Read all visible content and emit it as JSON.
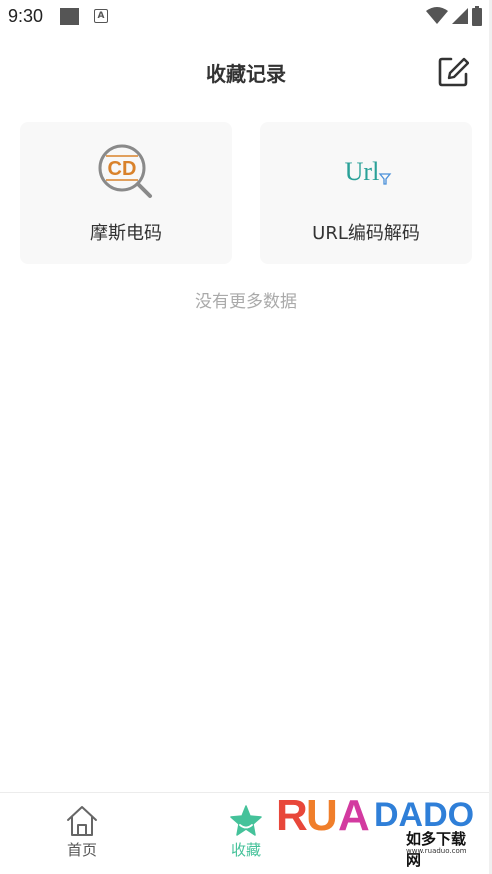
{
  "status_bar": {
    "time": "9:30",
    "icons": [
      "notification-square-icon",
      "a-badge-icon",
      "wifi-icon",
      "signal-icon",
      "battery-icon"
    ]
  },
  "header": {
    "title": "收藏记录",
    "edit_icon": "edit-square-icon"
  },
  "favorites": [
    {
      "label": "摩斯电码",
      "icon": "cd-magnifier-icon",
      "icon_text": "CD"
    },
    {
      "label": "URL编码解码",
      "icon": "url-filter-icon",
      "icon_text": "Url"
    }
  ],
  "empty_note": "没有更多数据",
  "bottom_nav": [
    {
      "label": "首页",
      "icon": "home-icon",
      "active": false
    },
    {
      "label": "收藏",
      "icon": "star-icon",
      "active": true
    }
  ],
  "watermark": {
    "logo": "RUANDADO",
    "chinese": "如多下载网",
    "url": "www.ruaduo.com"
  },
  "colors": {
    "accent_green": "#45c29a",
    "card_bg": "#f8f8f8",
    "cd_orange": "#d9822b",
    "url_teal": "#2aa198"
  }
}
